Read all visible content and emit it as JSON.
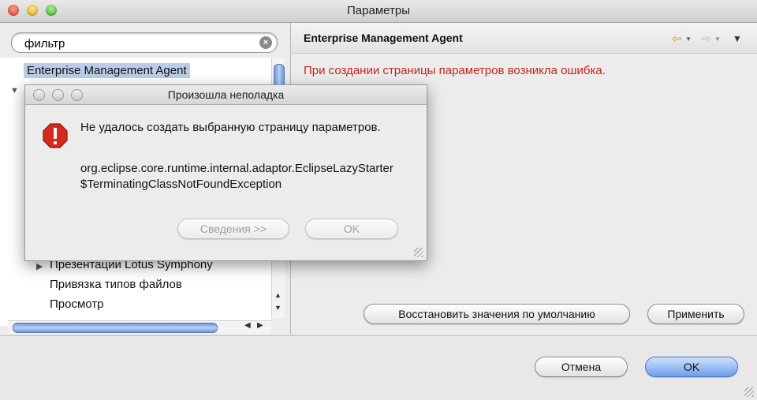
{
  "window": {
    "title": "Параметры"
  },
  "sidebar": {
    "filter_value": "фильтр",
    "items": [
      {
        "label": "Enterprise Management Agent"
      },
      {
        "label": "Презентации Lotus Symphony"
      },
      {
        "label": "Привязка типов файлов"
      },
      {
        "label": "Просмотр"
      }
    ]
  },
  "page": {
    "title": "Enterprise Management Agent",
    "error": "При создании страницы параметров возникла ошибка.",
    "restore_defaults_label": "Восстановить значения по умолчанию",
    "apply_label": "Применить"
  },
  "footer": {
    "cancel_label": "Отмена",
    "ok_label": "OK"
  },
  "dialog": {
    "title": "Произошла неполадка",
    "message": "Не удалось создать выбранную страницу параметров.",
    "detail": "org.eclipse.core.runtime.internal.adaptor.EclipseLazyStarter$TerminatingClassNotFoundException",
    "details_label": "Сведения >>",
    "ok_label": "OK"
  },
  "colors": {
    "error_text": "#c4261b",
    "selection": "#b9cde8",
    "accent": "#6f9fe9"
  }
}
